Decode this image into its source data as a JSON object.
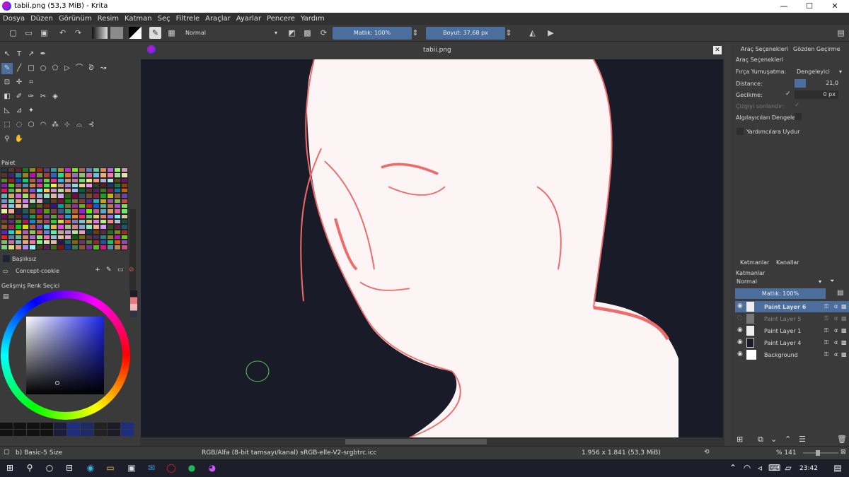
{
  "window": {
    "title": "tabii.png (53,3 MiB) - Krita",
    "minimize": "—",
    "maximize": "☐",
    "close": "✕"
  },
  "menu": [
    "Dosya",
    "Düzen",
    "Görünüm",
    "Resim",
    "Katman",
    "Seç",
    "Filtrele",
    "Araçlar",
    "Ayarlar",
    "Pencere",
    "Yardım"
  ],
  "toolbar": {
    "blend_mode": "Normal",
    "opacity": "Matlık: 100%",
    "size": "Boyut: 37,68 px"
  },
  "tool_options": {
    "tab_tool_options": "Araç Seçenekleri",
    "tab_overview": "Gözden Geçirme",
    "title": "Araç Seçenekleri",
    "smoothing_label": "Fırça Yumuşatma:",
    "smoothing_value": "Dengeleyici",
    "distance_label": "Distance:",
    "distance_value": "21,0",
    "delay_label": "Gecikme:",
    "delay_value": "0 px",
    "finish_line_label": "Çizgiyi sonlandır:",
    "stabilize_sensors_label": "Algılayıcıları Dengele:",
    "snap_assistant_label": "Yardımcılara Uydur"
  },
  "palette": {
    "title": "Palet",
    "swatch_name": "Başlıksız",
    "preset_name": "Concept-cookie"
  },
  "advanced_color": {
    "title": "Gelişmiş Renk Seçici"
  },
  "canvas": {
    "doc_tab": "tabii.png"
  },
  "layers": {
    "tab_layers": "Katmanlar",
    "tab_channels": "Kanallar",
    "title": "Katmanlar",
    "blend": "Normal",
    "opacity": "Matlık: 100%",
    "items": [
      {
        "name": "Paint Layer 6",
        "selected": true,
        "visible": true
      },
      {
        "name": "Paint Layer 5",
        "selected": false,
        "visible": false
      },
      {
        "name": "Paint Layer 1",
        "selected": false,
        "visible": true
      },
      {
        "name": "Paint Layer 4",
        "selected": false,
        "visible": true
      },
      {
        "name": "Background",
        "selected": false,
        "visible": true
      }
    ]
  },
  "status": {
    "brush": "b) Basic-5 Size",
    "colorspace": "RGB/Alfa (8-bit tamsayı/kanal)  sRGB-elle-V2-srgbtrc.icc",
    "dimensions": "1.956 x 1.841 (53,3 MiB)",
    "zoom": "% 141"
  },
  "taskbar": {
    "time": "23:42"
  },
  "colors": {
    "accent": "#4b6e9c",
    "sketch": "#f06a6a",
    "canvas_bg": "#1a1b28"
  }
}
